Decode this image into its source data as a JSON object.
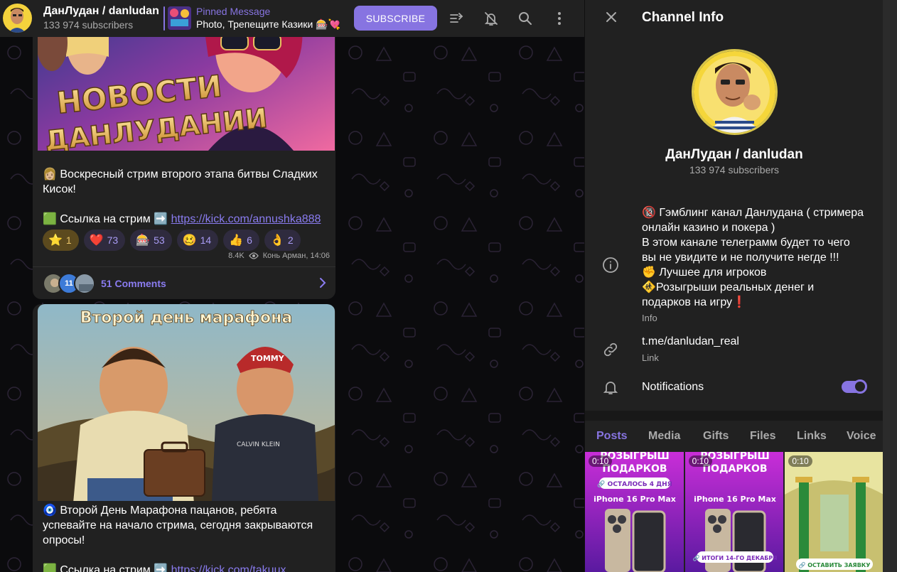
{
  "channel": {
    "title": "ДанЛудан / danludan",
    "subscribers": "133 974 subscribers"
  },
  "pinned": {
    "title": "Pinned Message",
    "text": "Photo, Трепещите Казики 🎰💘"
  },
  "header": {
    "subscribe_label": "SUBSCRIBE",
    "icons": [
      "boost-icon",
      "mute-icon",
      "search-icon",
      "more-icon"
    ]
  },
  "messages": [
    {
      "banner_text_1": "НОВОСТИ",
      "banner_text_2": "ДАНЛУДАНИИ",
      "text": "👩🏼 Воскресный стрим второго этапа битвы Сладких Кисок!",
      "link_prefix": "🟩 Ссылка на стрим ➡️",
      "link": "https://kick.com/annushka888",
      "reactions": [
        {
          "emoji": "⭐",
          "count": "1"
        },
        {
          "emoji": "❤️",
          "count": "73"
        },
        {
          "emoji": "🎰",
          "count": "53"
        },
        {
          "emoji": "🥴",
          "count": "14"
        },
        {
          "emoji": "👍",
          "count": "6"
        },
        {
          "emoji": "👌",
          "count": "2"
        }
      ],
      "views": "8.4K",
      "author_time": "Конь Арман, 14:06",
      "comments_avatar_count": "11",
      "comments_label": "51 Comments"
    },
    {
      "image_caption": "Второй день марафона",
      "cap_text": "TOMMY",
      "shirt_text": "CALVIN KLEIN",
      "text": "🧿 Второй День Марафона пацанов, ребята успевайте на начало стрима, сегодня закрываются опросы!",
      "link_prefix": "🟩 Ссылка на стрим ➡️",
      "link": "https://kick.com/takuux"
    }
  ],
  "panel": {
    "title": "Channel Info",
    "name": "ДанЛудан / danludan",
    "subscribers": "133 974 subscribers",
    "info_lines": [
      "🔞 Гэмблинг канал Данлудана ( стримера",
      "онлайн казино и покера )",
      "В этом канале телеграмм будет то чего",
      "вы не увидите и не получите негде !!!",
      "  ✊ Лучшее для игроков",
      "🚸Розыгрыши реальных денег и",
      "подарков на игру❗"
    ],
    "info_label": "Info",
    "link": "t.me/danludan_real",
    "link_label": "Link",
    "notifications_label": "Notifications",
    "notifications_on": true,
    "tabs": [
      "Posts",
      "Media",
      "Gifts",
      "Files",
      "Links",
      "Voice"
    ],
    "active_tab": "Posts",
    "media": [
      {
        "duration": "0:10",
        "line1": "РОЗЫГРЫШ",
        "line2": "ПОДАРКОВ",
        "badge": "🔗 ОСТАЛОСЬ 4 ДНЯ",
        "product": "iPhone 16 Pro Max"
      },
      {
        "duration": "0:10",
        "line1": "РОЗЫГРЫШ",
        "line2": "ПОДАРКОВ",
        "badge": "🔗 ИТОГИ 14-ГО ДЕКАБРЯ",
        "product": "iPhone 16 Pro Max"
      },
      {
        "duration": "0:10",
        "badge": "🔗 ОСТАВИТЬ ЗАЯВКУ"
      }
    ]
  },
  "colors": {
    "accent": "#8774e1",
    "panel_bg": "#212121",
    "chat_bg": "#0b0b0d"
  }
}
